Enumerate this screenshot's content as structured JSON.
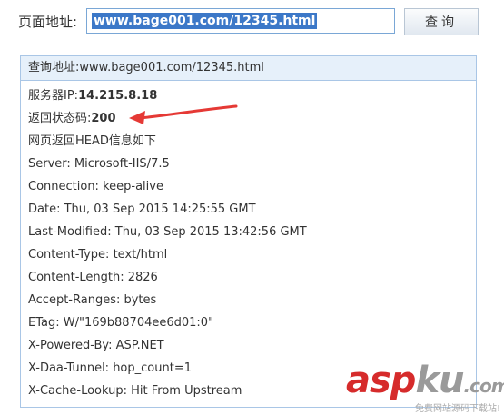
{
  "form": {
    "label": "页面地址:",
    "url_value": "www.bage001.com/12345.html",
    "submit_label": "查询"
  },
  "result": {
    "header": "查询地址:www.bage001.com/12345.html",
    "server_ip_label": "服务器IP:",
    "server_ip": "14.215.8.18",
    "status_label": "返回状态码:",
    "status_code": "200",
    "head_title": "网页返回HEAD信息如下",
    "headers": [
      "Server: Microsoft-IIS/7.5",
      "Connection: keep-alive",
      "Date: Thu, 03 Sep 2015 14:25:55 GMT",
      "Last-Modified: Thu, 03 Sep 2015 13:42:56 GMT",
      "Content-Type: text/html",
      "Content-Length: 2826",
      "Accept-Ranges: bytes",
      "ETag: W/\"169b88704ee6d01:0\"",
      "X-Powered-By: ASP.NET",
      "X-Daa-Tunnel: hop_count=1",
      "X-Cache-Lookup: Hit From Upstream"
    ]
  },
  "watermark": {
    "logo_part1": "asp",
    "logo_part2": "ku",
    "logo_part3": ".com",
    "tagline": "免费网站源码下载站!"
  },
  "colors": {
    "accent": "#3c78c8",
    "panel_border": "#a9c6e6",
    "panel_header_bg": "#e6f0fa",
    "arrow": "#e53935"
  }
}
